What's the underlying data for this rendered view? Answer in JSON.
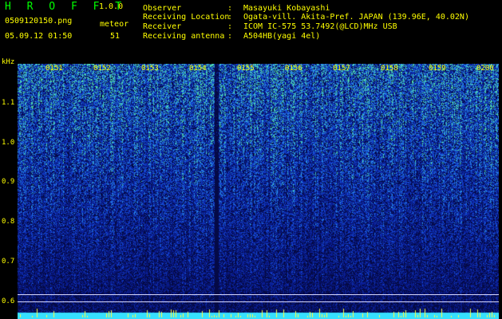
{
  "header": {
    "app_title": "H R O F F T",
    "version": "1.0.0",
    "filename": "0509120150.png",
    "meteor_label": "meteor",
    "datetime": "05.09.12 01:50",
    "meteor_count": "51"
  },
  "info": [
    {
      "key": "Observer",
      "sep": ":",
      "value": "Masayuki Kobayashi"
    },
    {
      "key": "Receiving Location",
      "sep": ":",
      "value": "Ogata-vill. Akita-Pref. JAPAN (139.96E, 40.02N)"
    },
    {
      "key": "Receiver",
      "sep": ":",
      "value": "ICOM IC-575 53.7492(@LCD)MHz USB"
    },
    {
      "key": "Receiving antenna",
      "sep": ":",
      "value": "A504HB(yagi 4el)"
    }
  ],
  "axis": {
    "unit": "kHz",
    "y_ticks": [
      "1.1",
      "1.0",
      "0.9",
      "0.8",
      "0.7",
      "0.6"
    ]
  },
  "time_ticks": [
    "0151",
    "0152",
    "0153",
    "0154",
    "0155",
    "0156",
    "0157",
    "0158",
    "0159",
    "0200"
  ],
  "colors": {
    "background": "#000000",
    "text": "#ffff00",
    "title": "#00ff00",
    "spectrum_low": "#0a1a70",
    "spectrum_high": "#3ad0a0"
  }
}
